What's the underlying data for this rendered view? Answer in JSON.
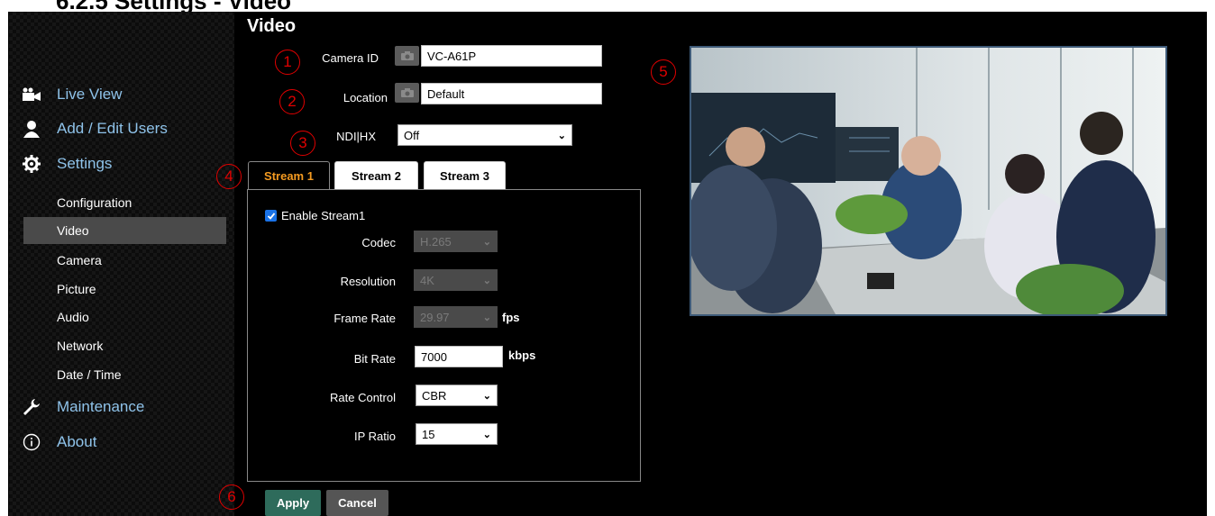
{
  "doc_heading": "6.2.5 Settings - Video",
  "sidebar": {
    "main_items": [
      {
        "label": "Live View",
        "icon": "video-camera-icon"
      },
      {
        "label": "Add / Edit Users",
        "icon": "user-icon"
      },
      {
        "label": "Settings",
        "icon": "gear-icon"
      },
      {
        "label": "Maintenance",
        "icon": "wrench-icon"
      },
      {
        "label": "About",
        "icon": "info-icon"
      }
    ],
    "sub_items": [
      "Configuration",
      "Video",
      "Camera",
      "Picture",
      "Audio",
      "Network",
      "Date / Time"
    ],
    "active_sub_item": "Video"
  },
  "page": {
    "title": "Video",
    "camera_id": {
      "label": "Camera ID",
      "value": "VC-A61P"
    },
    "location": {
      "label": "Location",
      "value": "Default"
    },
    "ndi_hx": {
      "label": "NDI|HX",
      "value": "Off"
    }
  },
  "tabs": [
    "Stream 1",
    "Stream 2",
    "Stream 3"
  ],
  "active_tab": "Stream 1",
  "stream": {
    "enable_label": "Enable Stream1",
    "enabled": true,
    "codec": {
      "label": "Codec",
      "value": "H.265"
    },
    "resolution": {
      "label": "Resolution",
      "value": "4K"
    },
    "frame_rate": {
      "label": "Frame Rate",
      "value": "29.97",
      "unit": "fps"
    },
    "bit_rate": {
      "label": "Bit Rate",
      "value": "7000",
      "unit": "kbps"
    },
    "rate_control": {
      "label": "Rate Control",
      "value": "CBR"
    },
    "ip_ratio": {
      "label": "IP Ratio",
      "value": "15"
    }
  },
  "buttons": {
    "apply": "Apply",
    "cancel": "Cancel"
  },
  "annotations": [
    "1",
    "2",
    "3",
    "4",
    "5",
    "6"
  ],
  "colors": {
    "accent_tab": "#f39a21",
    "nav_text": "#8fc3ea",
    "apply_bg": "#2e6b5b",
    "cancel_bg": "#555555",
    "annotation": "#e00000"
  }
}
